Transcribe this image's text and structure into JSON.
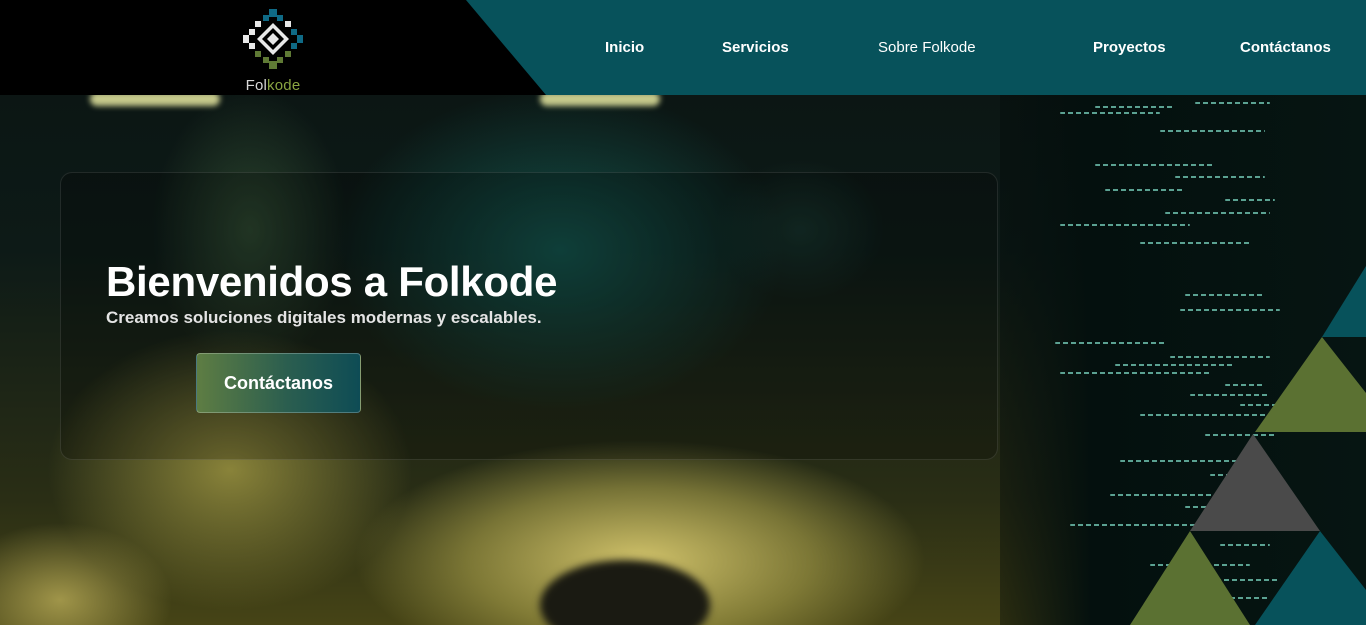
{
  "brand": {
    "name_part1": "Fol",
    "name_part2": "kode",
    "logo_icon": "folkode-diamond-logo-icon",
    "colors": {
      "teal": "#07525b",
      "olive": "#5b7132",
      "gray": "#4a4a4a",
      "logo_green": "#8aa542"
    }
  },
  "nav": {
    "items": [
      {
        "label": "Inicio"
      },
      {
        "label": "Servicios"
      },
      {
        "label": "Sobre Folkode"
      },
      {
        "label": "Proyectos"
      },
      {
        "label": "Contáctanos"
      }
    ]
  },
  "hero": {
    "title": "Bienvenidos a Folkode",
    "subtitle": "Creamos soluciones digitales modernas y escalables.",
    "cta_label": "Contáctanos"
  }
}
